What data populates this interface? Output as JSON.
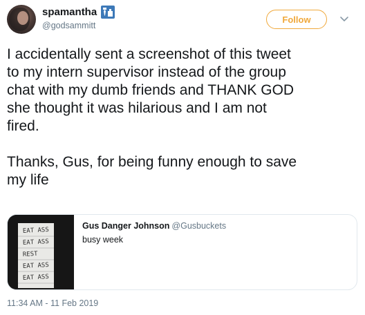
{
  "author": {
    "display_name": "spamantha",
    "handle": "@godsammitt",
    "badge_icon": "tie-icon",
    "avatar": "avatar"
  },
  "follow_button": {
    "label": "Follow",
    "accent": "#f0a83a"
  },
  "menu_icon": "chevron-down-icon",
  "tweet": {
    "text": "I accidentally sent a screenshot of this tweet\nto my intern supervisor instead of the group\nchat with my dumb friends and THANK GOD\nshe thought it was hilarious and I am not\nfired.\n\nThanks, Gus, for being funny enough to save\nmy life",
    "timestamp": "11:34 AM - 11 Feb 2019"
  },
  "quoted_tweet": {
    "display_name": "Gus Danger Johnson",
    "handle": "@Gusbuckets",
    "text": "busy week",
    "image_lines": [
      "EAT ASS",
      "EAT ASS",
      "REST",
      "EAT ASS",
      "EAT ASS"
    ]
  }
}
